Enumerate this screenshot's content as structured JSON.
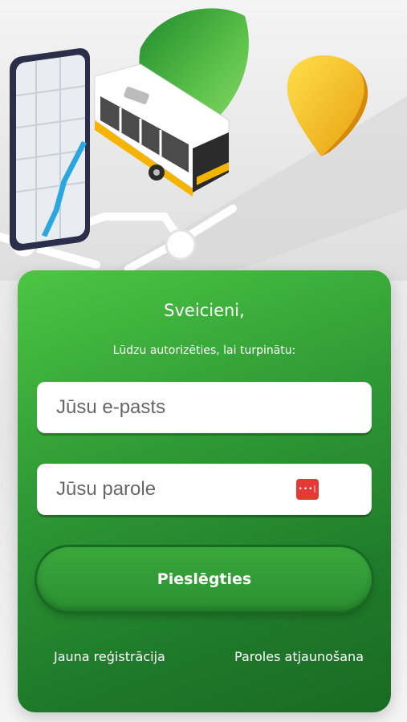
{
  "login": {
    "greeting": "Sveicieni,",
    "subtitle": "Lūdzu autorizēties, lai turpinātu:",
    "email_placeholder": "Jūsu e-pasts",
    "password_placeholder": "Jūsu parole",
    "password_manager_icon": "password-dots-icon",
    "submit_label": "Pieslēgties",
    "register_link": "Jauna reģistrācija",
    "reset_link": "Paroles atjaunošana"
  },
  "colors": {
    "card_green": "#3aa83c",
    "card_green_dark": "#1a6a24",
    "password_icon_red": "#e53935",
    "bus_yellow": "#f4b400",
    "map_pin_yellow": "#f7c81e"
  },
  "hero": {
    "illustration": "phone-map-bus-illustration"
  }
}
